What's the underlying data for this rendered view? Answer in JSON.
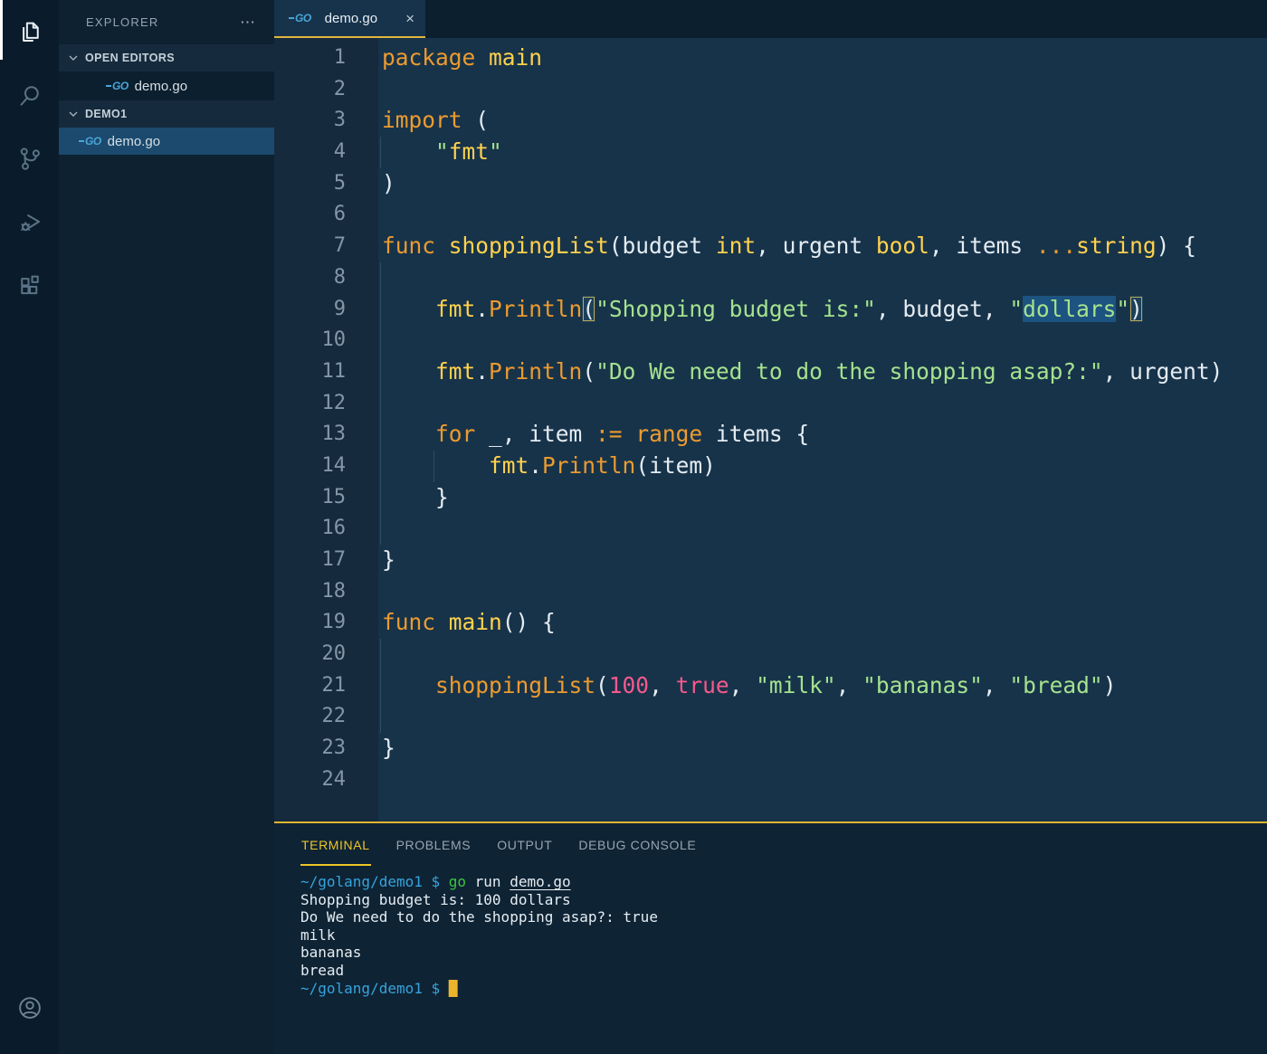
{
  "colors": {
    "accent_yellow": "#e2b53e",
    "panel_border": "#e0b52f",
    "selected_item_bg": "#1b4a6e",
    "go_brand_blue": "#4aa5d8",
    "syntax": {
      "keyword": "#ec9b2f",
      "type_and_decl": "#ffd24d",
      "string": "#a5e28e",
      "literal": "#f7598c",
      "default": "#e4ecf2"
    },
    "terminal": {
      "prompt_blue": "#37a3dc",
      "command_green": "#3fc43f",
      "cursor": "#ecb42d"
    }
  },
  "activity_bar": {
    "items": [
      {
        "name": "explorer",
        "active": true
      },
      {
        "name": "search",
        "active": false
      },
      {
        "name": "source-control",
        "active": false
      },
      {
        "name": "run-and-debug",
        "active": false
      },
      {
        "name": "extensions",
        "active": false
      }
    ],
    "bottom_items": [
      {
        "name": "account",
        "active": false
      }
    ]
  },
  "icons": {
    "go_badge": "GO",
    "ellipsis": "⋯",
    "close": "×",
    "cursor_block": "█"
  },
  "sidebar": {
    "title": "EXPLORER",
    "sections": [
      {
        "label": "OPEN EDITORS",
        "items": [
          {
            "label": "demo.go",
            "selected": false
          }
        ]
      },
      {
        "label": "DEMO1",
        "items": [
          {
            "label": "demo.go",
            "selected": true
          }
        ]
      }
    ]
  },
  "editor_tabs": [
    {
      "label": "demo.go",
      "active": true
    }
  ],
  "editor": {
    "language": "go",
    "lines": [
      {
        "n": 1,
        "g": [],
        "t": [
          [
            "kw",
            "package"
          ],
          [
            "df",
            " "
          ],
          [
            "ty",
            "main"
          ]
        ]
      },
      {
        "n": 2,
        "g": [],
        "t": []
      },
      {
        "n": 3,
        "g": [],
        "t": [
          [
            "kw",
            "import"
          ],
          [
            "df",
            " ("
          ]
        ]
      },
      {
        "n": 4,
        "g": [
          0
        ],
        "t": [
          [
            "df",
            "    "
          ],
          [
            "str",
            "\""
          ],
          [
            "ty",
            "fmt"
          ],
          [
            "str",
            "\""
          ]
        ]
      },
      {
        "n": 5,
        "g": [],
        "t": [
          [
            "df",
            ")"
          ]
        ]
      },
      {
        "n": 6,
        "g": [],
        "t": []
      },
      {
        "n": 7,
        "g": [],
        "t": [
          [
            "kw",
            "func"
          ],
          [
            "df",
            " "
          ],
          [
            "fn",
            "shoppingList"
          ],
          [
            "df",
            "(budget "
          ],
          [
            "ty",
            "int"
          ],
          [
            "df",
            ", urgent "
          ],
          [
            "ty",
            "bool"
          ],
          [
            "df",
            ", items "
          ],
          [
            "kw",
            "..."
          ],
          [
            "ty",
            "string"
          ],
          [
            "df",
            ") {"
          ]
        ]
      },
      {
        "n": 8,
        "g": [
          0
        ],
        "t": []
      },
      {
        "n": 9,
        "g": [
          0
        ],
        "t": [
          [
            "df",
            "    "
          ],
          [
            "ty",
            "fmt"
          ],
          [
            "df",
            "."
          ],
          [
            "call",
            "Println"
          ],
          [
            "brk",
            "("
          ],
          [
            "str",
            "\"Shopping budget is:\""
          ],
          [
            "df",
            ", budget, "
          ],
          [
            "str",
            "\""
          ],
          [
            "sel",
            "dollars"
          ],
          [
            "str",
            "\""
          ],
          [
            "brk",
            ")"
          ]
        ]
      },
      {
        "n": 10,
        "g": [
          0
        ],
        "t": []
      },
      {
        "n": 11,
        "g": [
          0
        ],
        "t": [
          [
            "df",
            "    "
          ],
          [
            "ty",
            "fmt"
          ],
          [
            "df",
            "."
          ],
          [
            "call",
            "Println"
          ],
          [
            "df",
            "("
          ],
          [
            "str",
            "\"Do We need to do the shopping asap?:\""
          ],
          [
            "df",
            ", urgent)"
          ]
        ]
      },
      {
        "n": 12,
        "g": [
          0
        ],
        "t": []
      },
      {
        "n": 13,
        "g": [
          0
        ],
        "t": [
          [
            "df",
            "    "
          ],
          [
            "kw",
            "for"
          ],
          [
            "df",
            " _, item "
          ],
          [
            "kw",
            ":="
          ],
          [
            "df",
            " "
          ],
          [
            "kw",
            "range"
          ],
          [
            "df",
            " items {"
          ]
        ]
      },
      {
        "n": 14,
        "g": [
          0,
          1
        ],
        "t": [
          [
            "df",
            "        "
          ],
          [
            "ty",
            "fmt"
          ],
          [
            "df",
            "."
          ],
          [
            "call",
            "Println"
          ],
          [
            "df",
            "(item)"
          ]
        ]
      },
      {
        "n": 15,
        "g": [
          0
        ],
        "t": [
          [
            "df",
            "    }"
          ]
        ]
      },
      {
        "n": 16,
        "g": [
          0
        ],
        "t": []
      },
      {
        "n": 17,
        "g": [],
        "t": [
          [
            "df",
            "}"
          ]
        ]
      },
      {
        "n": 18,
        "g": [],
        "t": []
      },
      {
        "n": 19,
        "g": [],
        "t": [
          [
            "kw",
            "func"
          ],
          [
            "df",
            " "
          ],
          [
            "fn",
            "main"
          ],
          [
            "df",
            "() {"
          ]
        ]
      },
      {
        "n": 20,
        "g": [
          0
        ],
        "t": []
      },
      {
        "n": 21,
        "g": [
          0
        ],
        "t": [
          [
            "df",
            "    "
          ],
          [
            "call",
            "shoppingList"
          ],
          [
            "df",
            "("
          ],
          [
            "num",
            "100"
          ],
          [
            "df",
            ", "
          ],
          [
            "num",
            "true"
          ],
          [
            "df",
            ", "
          ],
          [
            "str",
            "\"milk\""
          ],
          [
            "df",
            ", "
          ],
          [
            "str",
            "\"bananas\""
          ],
          [
            "df",
            ", "
          ],
          [
            "str",
            "\"bread\""
          ],
          [
            "df",
            ")"
          ]
        ]
      },
      {
        "n": 22,
        "g": [
          0
        ],
        "t": []
      },
      {
        "n": 23,
        "g": [],
        "t": [
          [
            "df",
            "}"
          ]
        ]
      },
      {
        "n": 24,
        "g": [],
        "t": []
      }
    ]
  },
  "panel": {
    "tabs": [
      {
        "label": "TERMINAL",
        "active": true
      },
      {
        "label": "PROBLEMS",
        "active": false
      },
      {
        "label": "OUTPUT",
        "active": false
      },
      {
        "label": "DEBUG CONSOLE",
        "active": false
      }
    ],
    "terminal_lines": [
      [
        [
          "tp",
          "~/golang/demo1 $ "
        ],
        [
          "tg",
          "go"
        ],
        [
          "td",
          " run "
        ],
        [
          "tu",
          "demo.go"
        ]
      ],
      [
        [
          "td",
          "Shopping budget is: 100 dollars"
        ]
      ],
      [
        [
          "td",
          "Do We need to do the shopping asap?: true"
        ]
      ],
      [
        [
          "td",
          "milk"
        ]
      ],
      [
        [
          "td",
          "bananas"
        ]
      ],
      [
        [
          "td",
          "bread"
        ]
      ],
      [
        [
          "tp",
          "~/golang/demo1 $ "
        ],
        [
          "cur",
          "█"
        ]
      ]
    ]
  }
}
